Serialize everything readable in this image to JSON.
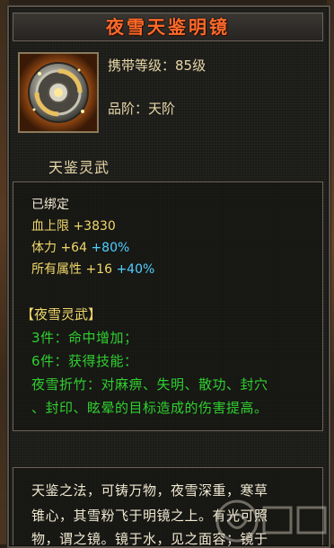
{
  "title": "夜雪天鉴明镜",
  "item": {
    "icon": "mirror-disc-icon",
    "level_label": "携带等级：85级",
    "grade_label": "品阶：天阶"
  },
  "section_label": "天鉴灵武",
  "stats": {
    "bound": "已绑定",
    "hp_label": "血上限",
    "hp_value": "+3830",
    "stamina_label": "体力",
    "stamina_value": "+64",
    "stamina_pct": "+80%",
    "all_attr_label": "所有属性",
    "all_attr_value": "+16",
    "all_attr_pct": "+40%"
  },
  "set": {
    "name": "【夜雪灵武】",
    "set3": "3件：命中增加；",
    "set6": "6件：获得技能：",
    "skill_line1": "夜雪折竹：对麻痹、失明、散功、封穴",
    "skill_line2": "、封印、眩晕的目标造成的伤害提高。"
  },
  "description": {
    "line1": "天鉴之法，可铸万物，夜雪深重，寒草",
    "line2": "锥心，其雪粉飞于明镜之上。有光可照",
    "line3": "物，谓之镜。镜于水，见之面容；镜于"
  },
  "colors": {
    "title": "#ff6a2a",
    "stat_yellow": "#f0d86a",
    "stat_cyan": "#4fd0ff",
    "set_green": "#2fd02f"
  }
}
